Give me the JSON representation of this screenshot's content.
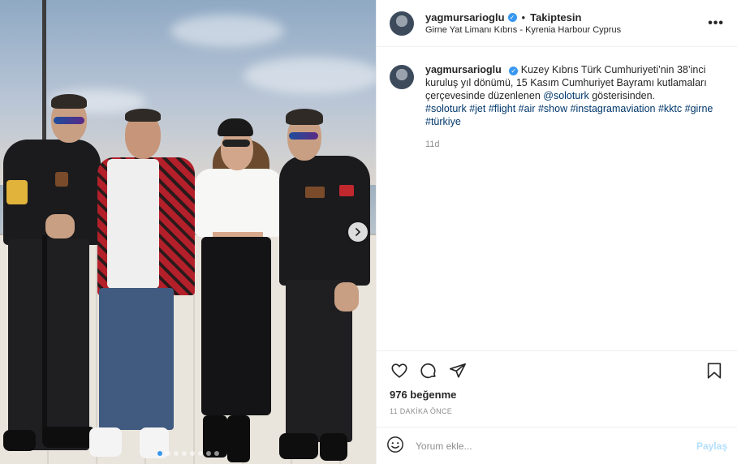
{
  "post": {
    "username": "yagmursarioglu",
    "follow_status": "Takiptesin",
    "location": "Girne Yat Limanı Kıbrıs - Kyrenia Harbour Cyprus",
    "caption": {
      "text_part1": "Kuzey Kıbrıs Türk Cumhuriyeti’nin 38’inci kuruluş yıl dönümü, 15 Kasım Cumhuriyet Bayramı kutlamaları çerçevesinde düzenlenen ",
      "mention": "@soloturk",
      "text_part2": " gösterisinden.",
      "hashtags": "#soloturk #jet #flight #air #show #instagramaviation #kktc #girne #türkiye"
    },
    "caption_age": "11d",
    "likes": "976 beğenme",
    "posted_ago": "11 DAKİKA ÖNCE",
    "comment_placeholder": "Yorum ekle...",
    "post_button": "Paylaş",
    "carousel": {
      "count": 8,
      "active_index": 0
    }
  },
  "colors": {
    "verified": "#3897f0",
    "link": "#00376b",
    "muted": "#8e8e8e",
    "post_disabled": "#b2dffc"
  },
  "icons": [
    "more-icon",
    "heart-icon",
    "comment-icon",
    "share-icon",
    "bookmark-icon",
    "emoji-icon",
    "chevron-right-icon",
    "verified-icon"
  ]
}
